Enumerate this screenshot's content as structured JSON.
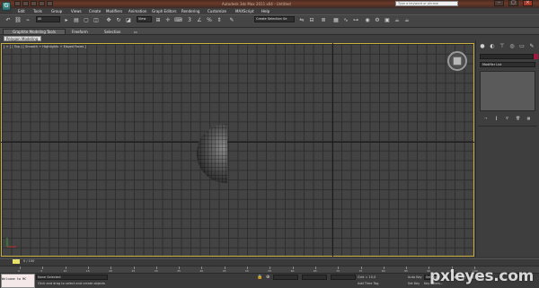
{
  "window": {
    "app_logo": "G",
    "title": "Autodesk 3ds Max 2011 x64 - Untitled",
    "search_placeholder": "Type a keyword or phrase",
    "minimize": "–",
    "maximize": "□",
    "close": "×"
  },
  "menu": {
    "items": [
      "Edit",
      "Tools",
      "Group",
      "Views",
      "Create",
      "Modifiers",
      "Animation",
      "Graph Editors",
      "Rendering",
      "Customize",
      "MAXScript",
      "Help"
    ]
  },
  "toolbar": {
    "selection_filter": "All",
    "reference_coord": "View",
    "named_selection": "Create Selection Se"
  },
  "ribbon": {
    "tabs": [
      "Graphite Modeling Tools",
      "Freeform",
      "Selection"
    ],
    "panel_label": "Polygon Modeling"
  },
  "viewport": {
    "label": "[ + ] [ Top ] [ Smooth + Highlights + Edged Faces ]"
  },
  "command_panel": {
    "modifier_list": "Modifier List"
  },
  "timeline": {
    "frame_display": "0 / 100",
    "tick_labels": [
      "0",
      "5",
      "10",
      "15",
      "20",
      "25",
      "30",
      "35",
      "40",
      "45",
      "50",
      "55",
      "60",
      "65",
      "70",
      "75",
      "80",
      "85",
      "90",
      "95",
      "100"
    ]
  },
  "status": {
    "maxscript_text": "Welcome to MC",
    "selection_text": "None Selected",
    "prompt_text": "Click and drag to select and create objects",
    "grid_text": "Grid = 10.0",
    "add_time_tag": "Add Time Tag",
    "auto_key": "Auto Key",
    "set_key": "Set Key",
    "selected": "Selected",
    "key_filters": "Key Filters..."
  },
  "watermark": "pxleyes.com",
  "colors": {
    "accent_viewport_border": "#c8b040",
    "object_color": "#a01a40"
  }
}
